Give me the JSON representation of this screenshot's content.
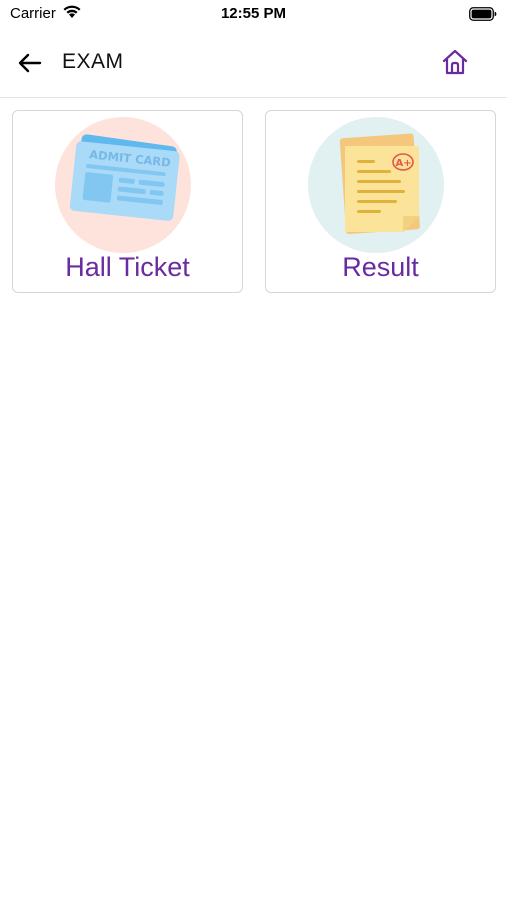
{
  "status_bar": {
    "carrier": "Carrier",
    "time": "12:55 PM"
  },
  "header": {
    "title": "EXAM",
    "back_icon": "arrow-left-icon",
    "home_icon": "home-icon"
  },
  "tiles": [
    {
      "label": "Hall Ticket",
      "image_text": "ADMIT CARD",
      "icon": "admit-card-illustration",
      "circle_color": "#fde3dc"
    },
    {
      "label": "Result",
      "image_text": "A+",
      "icon": "result-sheet-illustration",
      "circle_color": "#e1f0f1"
    }
  ],
  "colors": {
    "accent": "#6a2aa0",
    "card_border": "#d6d6d6"
  }
}
